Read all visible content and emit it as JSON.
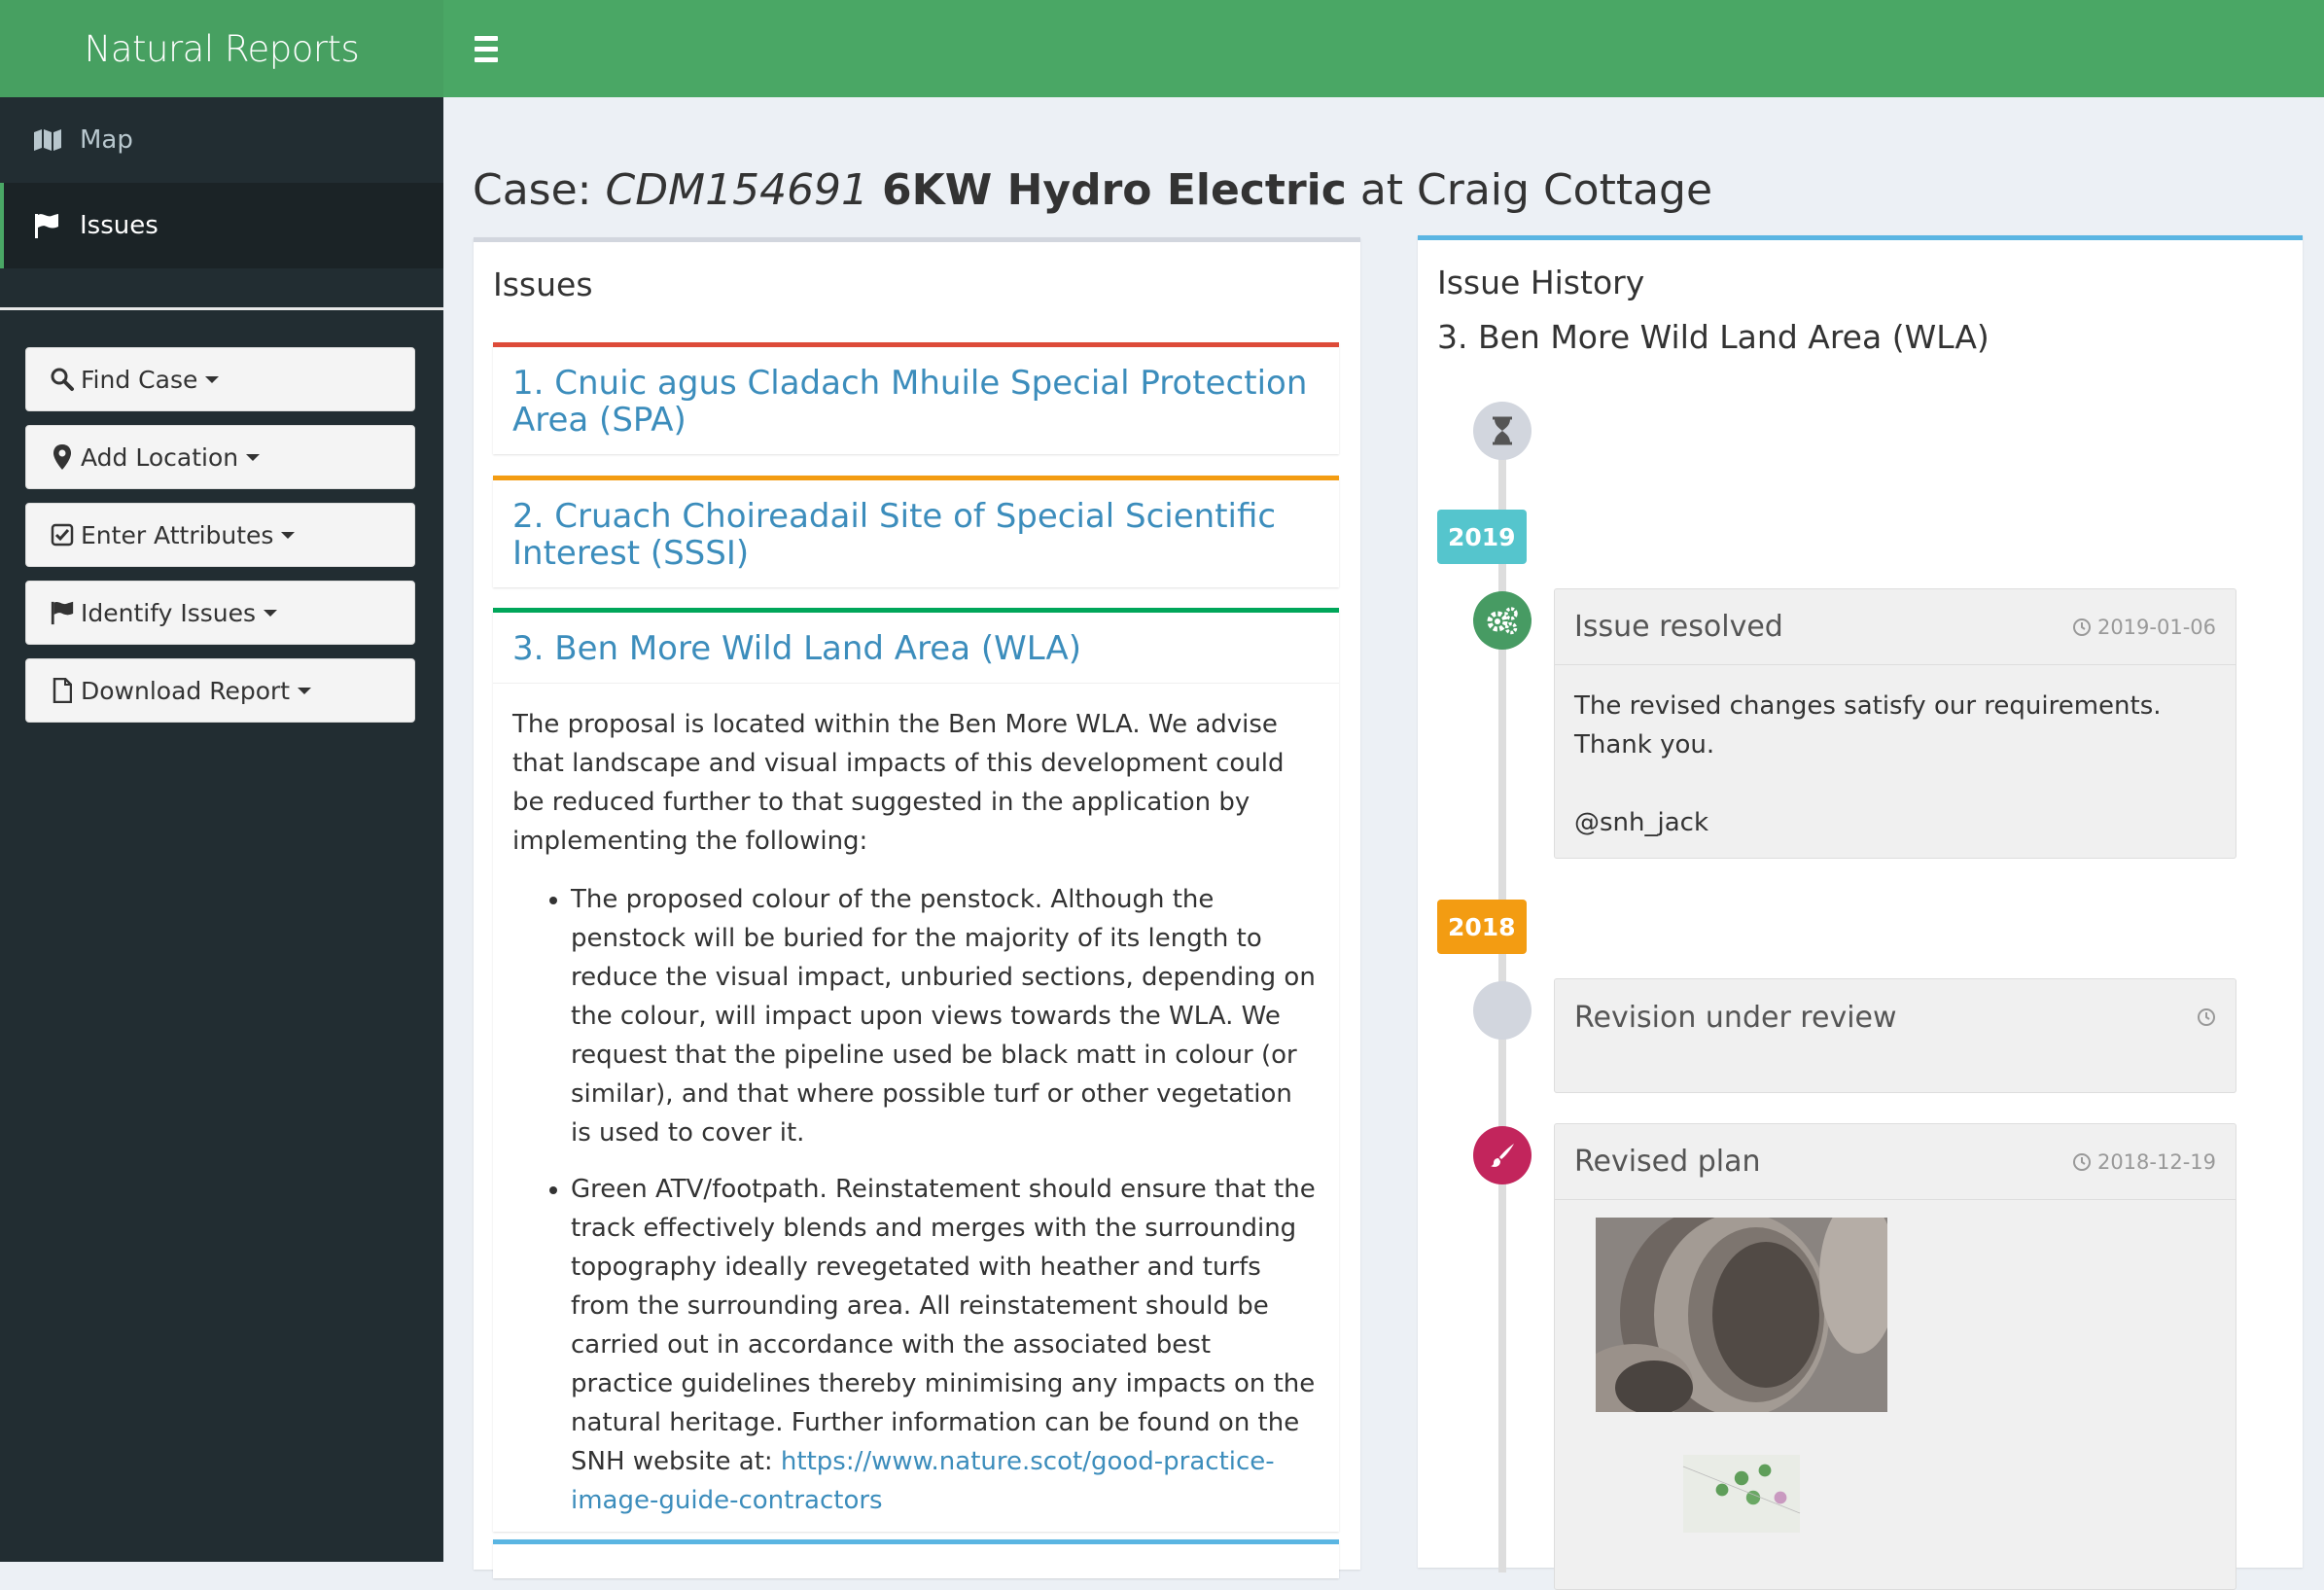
{
  "app": {
    "title": "Natural Reports"
  },
  "sidebar": {
    "items": [
      {
        "label": "Map",
        "icon": "map-icon",
        "active": false
      },
      {
        "label": "Issues",
        "icon": "flag-icon",
        "active": true
      }
    ],
    "buttons": [
      {
        "label": "Find Case",
        "icon": "search-icon"
      },
      {
        "label": "Add Location",
        "icon": "map-marker-icon"
      },
      {
        "label": "Enter Attributes",
        "icon": "checkbox-icon"
      },
      {
        "label": "Identify Issues",
        "icon": "flag-icon"
      },
      {
        "label": "Download Report",
        "icon": "file-icon"
      }
    ]
  },
  "page": {
    "title_prefix": "Case:",
    "case_id": "CDM154691",
    "case_name": "6KW Hydro Electric",
    "title_suffix": "at Craig Cottage"
  },
  "issues": {
    "title": "Issues",
    "list": [
      {
        "title": "1. Cnuic agus Cladach Mhuile Special Protection Area (SPA)",
        "color": "#dd4b39"
      },
      {
        "title": "2. Cruach Choireadail Site of Special Scientific Interest (SSSI)",
        "color": "#f39c12"
      },
      {
        "title": "3. Ben More Wild Land Area (WLA)",
        "color": "#00a65a"
      }
    ],
    "expanded": {
      "intro": "The proposal is located within the Ben More WLA. We advise that landscape and visual impacts of this development could be reduced further to that suggested in the application by implementing the following:",
      "bullet_1": "The proposed colour of the penstock. Although the penstock will be buried for the majority of its length to reduce the visual impact, unburied sections, depending on the colour, will impact upon views towards the WLA. We request that the pipeline used be black matt in colour (or similar), and that where possible turf or other vegetation is used to cover it.",
      "bullet_2": "Green ATV/footpath. Reinstatement should ensure that the track effectively blends and merges with the surrounding topography ideally revegetated with heather and turfs from the surrounding area. All reinstatement should be carried out in accordance with the associated best practice guidelines thereby minimising any impacts on the natural heritage. Further information can be found on the SNH website at:",
      "link": "https://www.nature.scot/good-practice-image-guide-contractors"
    }
  },
  "history": {
    "title": "Issue History",
    "subtitle": "3. Ben More Wild Land Area (WLA)",
    "labels": {
      "y2019": "2019",
      "y2018": "2018"
    },
    "events": {
      "resolved": {
        "title": "Issue resolved",
        "date": "2019-01-06",
        "body": "The revised changes satisfy our requirements. Thank you.",
        "user": "@snh_jack"
      },
      "review": {
        "title": "Revision under review"
      },
      "plan": {
        "title": "Revised plan",
        "date": "2018-12-19"
      }
    }
  },
  "colors": {
    "brand": "#4aa765",
    "sidebar": "#222d32",
    "link": "#3c8dbc",
    "year_2019": "#55c5cd",
    "year_2018": "#f39c12"
  }
}
